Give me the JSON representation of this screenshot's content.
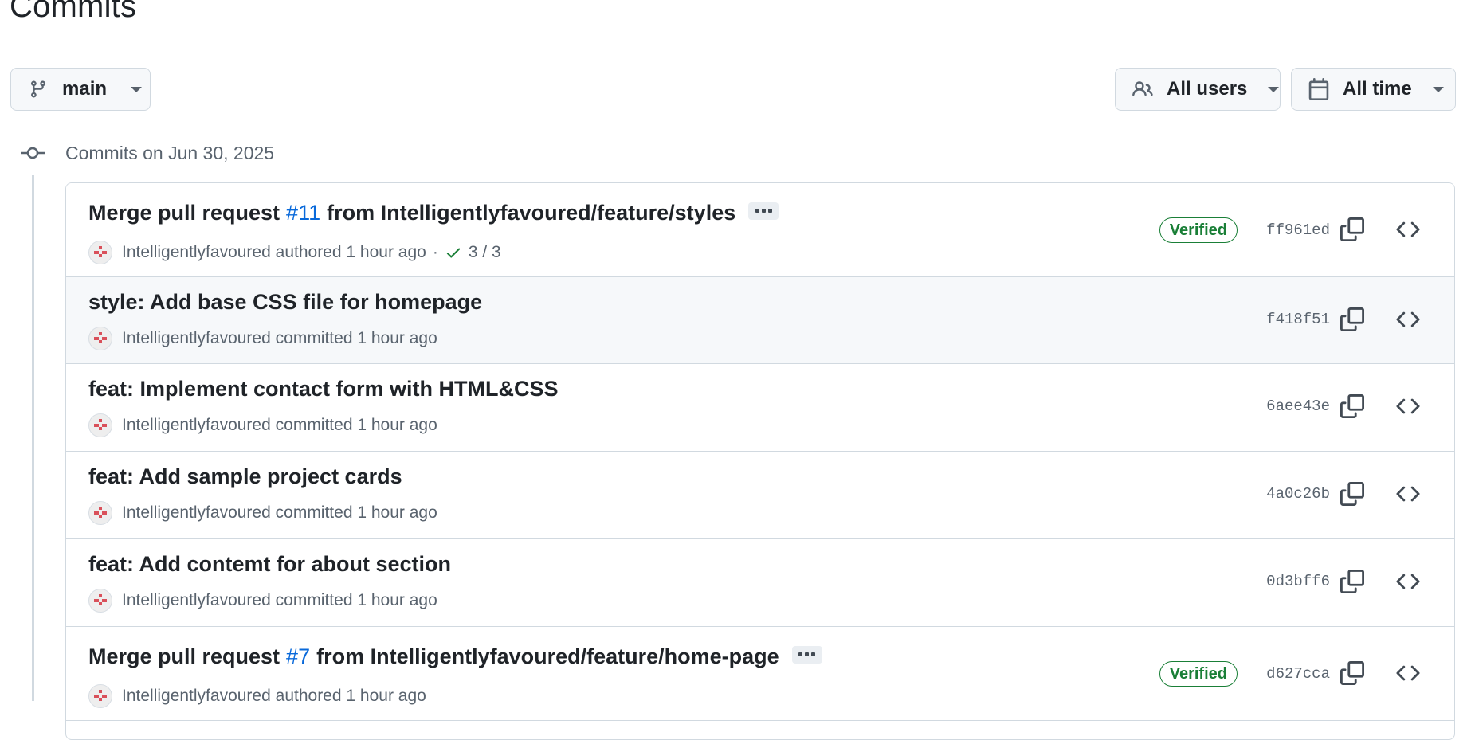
{
  "page": {
    "title": "Commits"
  },
  "toolbar": {
    "branch": "main",
    "users": "All users",
    "time": "All time"
  },
  "group": {
    "title": "Commits on Jun 30, 2025"
  },
  "commits": [
    {
      "prefix": "Merge pull request",
      "pr": "#11",
      "suffix": "from Intelligentlyfavoured/feature/styles",
      "author": "Intelligentlyfavoured",
      "action": "authored",
      "time": "1 hour ago",
      "checks": "3 / 3",
      "verified": "Verified",
      "sha": "ff961ed"
    },
    {
      "title": "style: Add base CSS file for homepage",
      "author": "Intelligentlyfavoured",
      "action": "committed",
      "time": "1 hour ago",
      "sha": "f418f51"
    },
    {
      "title": "feat: Implement contact form with HTML&CSS",
      "author": "Intelligentlyfavoured",
      "action": "committed",
      "time": "1 hour ago",
      "sha": "6aee43e"
    },
    {
      "title": "feat: Add sample project cards",
      "author": "Intelligentlyfavoured",
      "action": "committed",
      "time": "1 hour ago",
      "sha": "4a0c26b"
    },
    {
      "title": "feat: Add contemt for about section",
      "author": "Intelligentlyfavoured",
      "action": "committed",
      "time": "1 hour ago",
      "sha": "0d3bff6"
    },
    {
      "prefix": "Merge pull request",
      "pr": "#7",
      "suffix": "from Intelligentlyfavoured/feature/home-page",
      "author": "Intelligentlyfavoured",
      "action": "authored",
      "time": "1 hour ago",
      "verified": "Verified",
      "sha": "d627cca"
    }
  ],
  "colors": {
    "link": "#0969da",
    "verified": "#1a7f37",
    "muted": "#59636e",
    "border": "#d1d9e0"
  }
}
